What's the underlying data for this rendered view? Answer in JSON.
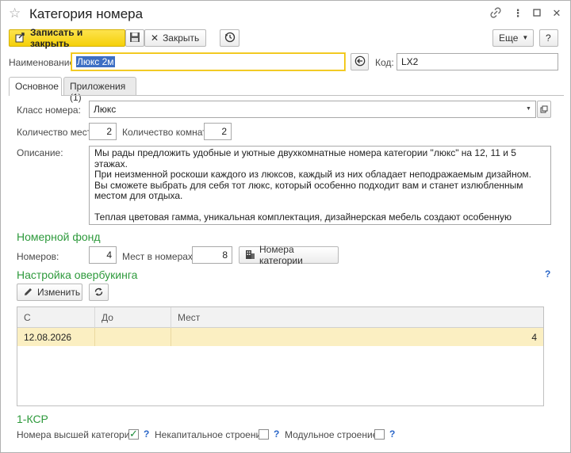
{
  "window": {
    "title": "Категория номера",
    "icons": {
      "favorite": "star-icon",
      "link": "link-icon",
      "menu": "more-icon",
      "maximize": "maximize-icon",
      "close": "close-icon"
    }
  },
  "toolbar": {
    "save_close": "Записать и закрыть",
    "close": "Закрыть",
    "more": "Еще",
    "help": "?"
  },
  "header": {
    "name_label": "Наименование:",
    "name_value": "Люкс 2м",
    "code_label": "Код:",
    "code_value": "LX2"
  },
  "tabs": [
    {
      "label": "Основное",
      "active": true
    },
    {
      "label": "Приложения (1)",
      "active": false
    }
  ],
  "main": {
    "class_label": "Класс номера:",
    "class_value": "Люкс",
    "places_label": "Количество мест:",
    "places_value": "2",
    "rooms_label": "Количество комнат:",
    "rooms_value": "2",
    "description_label": "Описание:",
    "description": "Мы рады предложить удобные и уютные двухкомнатные номера категории \"люкс\" на 12, 11 и 5 этажах.\nПри неизменной роскоши каждого из люксов, каждый из них обладает неподражаемым дизайном. Вы сможете выбрать для себя тот люкс, который особенно подходит вам и станет излюбленным местом для отдыха.\n\nТеплая цветовая гамма, уникальная комплектация, дизайнерская мебель создают особенную атмосферу в номерах.\nСтильная и просторная гостиная с мягким диваном, рабочей зоной, кофемашиной и мини-холодильником."
  },
  "room_fund": {
    "title": "Номерной фонд",
    "rooms_label": "Номеров:",
    "rooms_value": "4",
    "places_label": "Мест в номерах:",
    "places_value": "8",
    "categories_button": "Номера категории"
  },
  "overbooking": {
    "title": "Настройка овербукинга",
    "help": "?",
    "edit_button": "Изменить",
    "columns": [
      "С",
      "До",
      "Мест"
    ],
    "rows": [
      {
        "from": "12.08.2026",
        "to": "",
        "places": "4"
      }
    ]
  },
  "ksr": {
    "title": "1-КСР",
    "higher_category_label": "Номера высшей категории:",
    "higher_category_checked": true,
    "non_capital_label": "Некапитальное строение:",
    "non_capital_checked": false,
    "modular_label": "Модульное строение:",
    "modular_checked": false,
    "help": "?"
  },
  "colors": {
    "accent_yellow": "#f5d009",
    "section_green": "#2e9a3c",
    "selected_row": "#fbefc2",
    "help_blue": "#2a66c8"
  }
}
